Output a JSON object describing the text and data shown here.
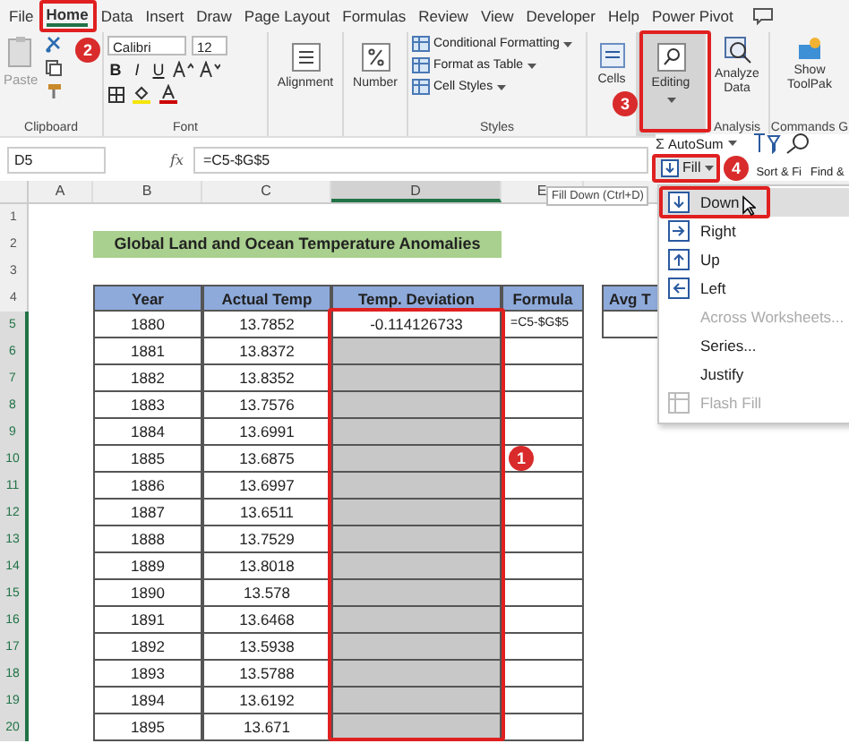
{
  "ribbon_tabs": [
    {
      "label": "File",
      "selected": false
    },
    {
      "label": "Home",
      "selected": true
    },
    {
      "label": "Data",
      "selected": false
    },
    {
      "label": "Insert",
      "selected": false
    },
    {
      "label": "Draw",
      "selected": false
    },
    {
      "label": "Page Layout",
      "selected": false
    },
    {
      "label": "Formulas",
      "selected": false
    },
    {
      "label": "Review",
      "selected": false
    },
    {
      "label": "View",
      "selected": false
    },
    {
      "label": "Developer",
      "selected": false
    },
    {
      "label": "Help",
      "selected": false
    },
    {
      "label": "Power Pivot",
      "selected": false
    }
  ],
  "clipboard": {
    "paste": "Paste",
    "group": "Clipboard"
  },
  "font": {
    "name": "Calibri",
    "size": "12",
    "bold": "B",
    "italic": "I",
    "underline": "U",
    "group": "Font"
  },
  "alignment": {
    "label": "Alignment"
  },
  "number": {
    "label": "Number"
  },
  "styles": {
    "items": [
      "Conditional Formatting",
      "Format as Table",
      "Cell Styles"
    ],
    "group": "Styles"
  },
  "cells": {
    "label": "Cells"
  },
  "editing": {
    "label": "Editing",
    "highlighted": true
  },
  "analysis": {
    "button": "Analyze Data",
    "group": "Analysis"
  },
  "commands": {
    "button": "Show ToolPak",
    "group": "Commands G"
  },
  "editing_panel": {
    "sigma": "Σ",
    "autosum": "AutoSum",
    "fill": "Fill",
    "sort": "Sort & Fi",
    "find": "Find &"
  },
  "formula_bar": {
    "cell": "D5",
    "fx": "fx",
    "formula": "=C5-$G$5"
  },
  "sheet": {
    "columns": [
      "A",
      "B",
      "C",
      "D",
      "E"
    ],
    "row_numbers": [
      "1",
      "2",
      "3",
      "4",
      "5",
      "6",
      "7",
      "8",
      "9",
      "10",
      "11",
      "12",
      "13",
      "14",
      "15",
      "16",
      "17",
      "18",
      "19",
      "20"
    ],
    "title": "Global Land and Ocean Temperature Anomalies",
    "headers": [
      "Year",
      "Actual Temp",
      "Temp. Deviation",
      "Formula"
    ],
    "side_header": "Avg T",
    "rows": [
      {
        "year": "1880",
        "temp": "13.7852",
        "deviation": "-0.114126733",
        "formula": "=C5-$G$5",
        "highlighted": false
      },
      {
        "year": "1881",
        "temp": "13.8372",
        "highlighted": true
      },
      {
        "year": "1882",
        "temp": "13.8352",
        "highlighted": true
      },
      {
        "year": "1883",
        "temp": "13.7576",
        "highlighted": true
      },
      {
        "year": "1884",
        "temp": "13.6991",
        "highlighted": true
      },
      {
        "year": "1885",
        "temp": "13.6875",
        "highlighted": true
      },
      {
        "year": "1886",
        "temp": "13.6997",
        "highlighted": true
      },
      {
        "year": "1887",
        "temp": "13.6511",
        "highlighted": true
      },
      {
        "year": "1888",
        "temp": "13.7529",
        "highlighted": true
      },
      {
        "year": "1889",
        "temp": "13.8018",
        "highlighted": true
      },
      {
        "year": "1890",
        "temp": "13.578",
        "highlighted": true
      },
      {
        "year": "1891",
        "temp": "13.6468",
        "highlighted": true
      },
      {
        "year": "1892",
        "temp": "13.5938",
        "highlighted": true
      },
      {
        "year": "1893",
        "temp": "13.5788",
        "highlighted": true
      },
      {
        "year": "1894",
        "temp": "13.6192",
        "highlighted": true
      },
      {
        "year": "1895",
        "temp": "13.671",
        "highlighted": true
      }
    ]
  },
  "tooltip": "Fill Down (Ctrl+D)",
  "fill_menu": [
    {
      "label": "Down",
      "kind": "arrow-down",
      "selected": true,
      "disabled": false
    },
    {
      "label": "Right",
      "kind": "arrow-right",
      "selected": false,
      "disabled": false
    },
    {
      "label": "Up",
      "kind": "arrow-up",
      "selected": false,
      "disabled": false
    },
    {
      "label": "Left",
      "kind": "arrow-left",
      "selected": false,
      "disabled": false
    },
    {
      "label": "Across Worksheets...",
      "kind": "plain",
      "selected": false,
      "disabled": true
    },
    {
      "label": "Series...",
      "kind": "plain",
      "selected": false,
      "disabled": false
    },
    {
      "label": "Justify",
      "kind": "plain",
      "selected": false,
      "disabled": false
    },
    {
      "label": "Flash Fill",
      "kind": "flash",
      "selected": false,
      "disabled": true
    }
  ],
  "step_badges": [
    "1",
    "2",
    "3",
    "4"
  ]
}
